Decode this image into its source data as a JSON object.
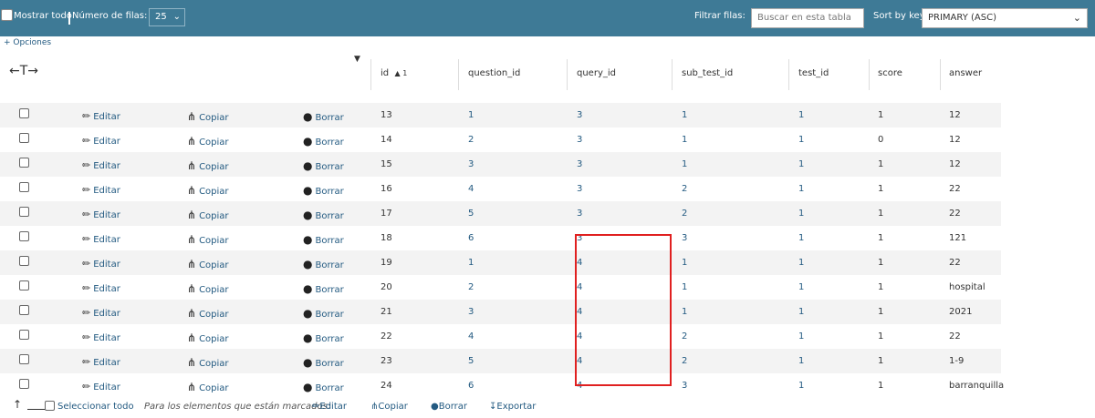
{
  "topbar": {
    "show_all_label": "Mostrar todo",
    "rows_label": "Número de filas:",
    "rows_value": "25",
    "filter_label": "Filtrar filas:",
    "filter_placeholder": "Buscar en esta tabla",
    "sort_label": "Sort by key:",
    "sort_value": "PRIMARY (ASC)"
  },
  "options_link": "+ Opciones",
  "columns": [
    "id",
    "question_id",
    "query_id",
    "sub_test_id",
    "test_id",
    "score",
    "answer"
  ],
  "sort_indicator": "▲ 1",
  "actions": {
    "edit": "Editar",
    "copy": "Copiar",
    "delete": "Borrar"
  },
  "rows": [
    [
      "13",
      "1",
      "3",
      "1",
      "1",
      "1",
      "12"
    ],
    [
      "14",
      "2",
      "3",
      "1",
      "1",
      "0",
      "12"
    ],
    [
      "15",
      "3",
      "3",
      "1",
      "1",
      "1",
      "12"
    ],
    [
      "16",
      "4",
      "3",
      "2",
      "1",
      "1",
      "22"
    ],
    [
      "17",
      "5",
      "3",
      "2",
      "1",
      "1",
      "22"
    ],
    [
      "18",
      "6",
      "3",
      "3",
      "1",
      "1",
      "121"
    ],
    [
      "19",
      "1",
      "4",
      "1",
      "1",
      "1",
      "22"
    ],
    [
      "20",
      "2",
      "4",
      "1",
      "1",
      "1",
      "hospital"
    ],
    [
      "21",
      "3",
      "4",
      "1",
      "1",
      "1",
      "2021"
    ],
    [
      "22",
      "4",
      "4",
      "2",
      "1",
      "1",
      "22"
    ],
    [
      "23",
      "5",
      "4",
      "2",
      "1",
      "1",
      "1-9"
    ],
    [
      "24",
      "6",
      "4",
      "3",
      "1",
      "1",
      "barranquilla"
    ]
  ],
  "bottombar": {
    "select_all": "Seleccionar todo",
    "with_selected": "Para los elementos que están marcados:",
    "edit": "Editar",
    "copy": "Copiar",
    "delete": "Borrar",
    "export": "Exportar"
  },
  "colors": {
    "topbar": "#3e7a96",
    "link": "#235a81",
    "highlight": "#e02020"
  }
}
